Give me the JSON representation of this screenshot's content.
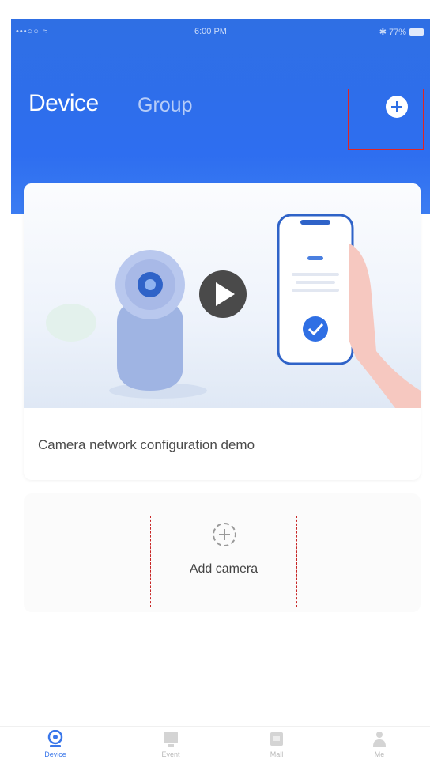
{
  "status_bar": {
    "signal": "•••○○ ≈",
    "time": "6:00 PM",
    "battery_text": "✱ 77%"
  },
  "header": {
    "tab_device": "Device",
    "tab_group": "Group",
    "add_button_icon": "plus-circle-icon"
  },
  "demo_card": {
    "title": "Camera network configuration demo",
    "illustration_icons": [
      "camera-icon",
      "play-icon",
      "phone-icon",
      "check-icon",
      "hand-icon"
    ]
  },
  "add_camera": {
    "label": "Add camera",
    "icon": "dashed-plus-icon"
  },
  "bottom_nav": {
    "items": [
      {
        "label": "Device",
        "icon": "device-icon",
        "active": true
      },
      {
        "label": "Event",
        "icon": "event-icon",
        "active": false
      },
      {
        "label": "Mall",
        "icon": "mall-icon",
        "active": false
      },
      {
        "label": "Me",
        "icon": "profile-icon",
        "active": false
      }
    ]
  },
  "colors": {
    "header_blue": "#2f6fe4",
    "accent_blue": "#3a77ea",
    "highlight_red": "#e02424"
  }
}
